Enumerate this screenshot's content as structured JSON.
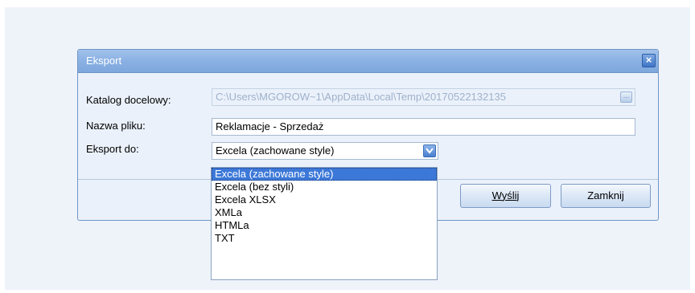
{
  "dialog": {
    "title": "Eksport",
    "close_label": "×"
  },
  "form": {
    "catalog_label": "Katalog docelowy:",
    "catalog_value": "C:\\Users\\MGOROW~1\\AppData\\Local\\Temp\\20170522132135",
    "filename_label": "Nazwa pliku:",
    "filename_value": "Reklamacje - Sprzedaż",
    "export_label": "Eksport do:",
    "export_value": "Excela (zachowane style)"
  },
  "buttons": {
    "send_label": "Wyślij",
    "close_label": "Zamknij"
  },
  "dropdown": {
    "options": [
      "Excela (zachowane style)",
      "Excela (bez styli)",
      "Excela XLSX",
      "XMLa",
      "HTMLa",
      "TXT"
    ],
    "selected_index": 0
  },
  "colors": {
    "titlebar": "#8cb2e4",
    "dialog_bg": "#eaf1fa",
    "selection": "#3c78d8"
  }
}
